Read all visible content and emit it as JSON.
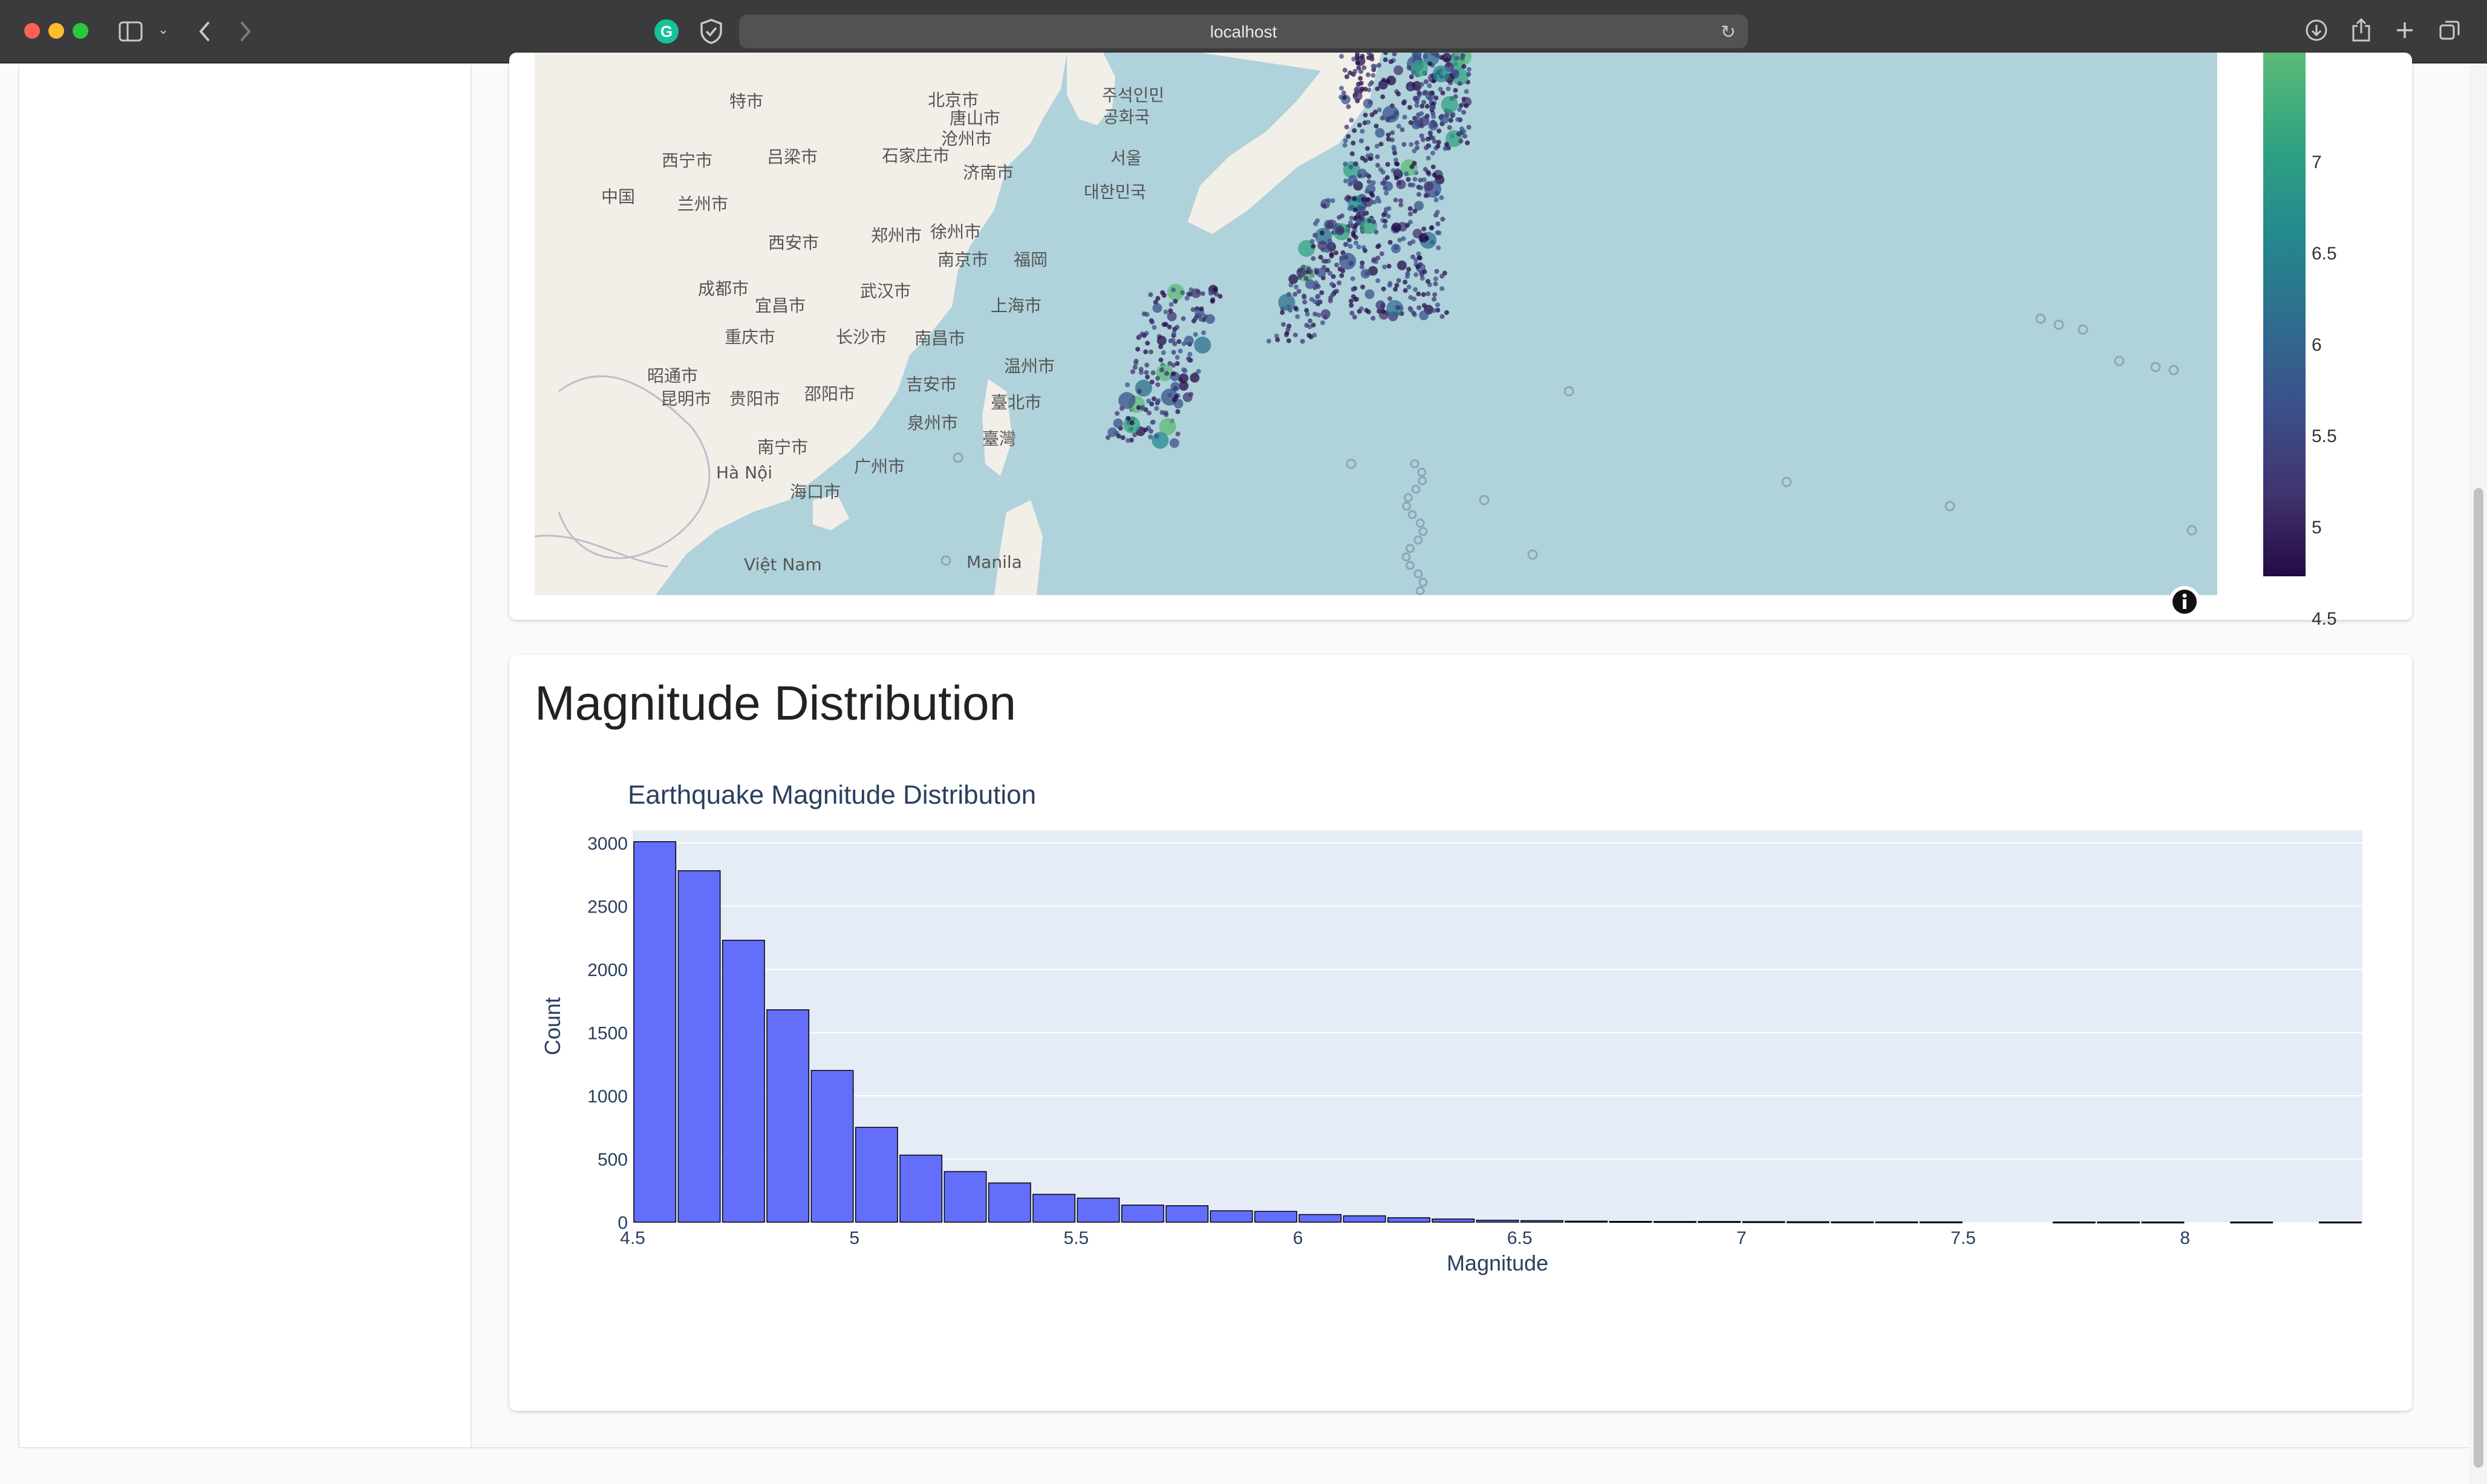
{
  "browser": {
    "url": "localhost",
    "extension_grammarly": "G"
  },
  "map": {
    "labels": [
      {
        "t": "北京市"
      },
      {
        "t": "唐山市"
      },
      {
        "t": "沧州市"
      },
      {
        "t": "济南市"
      },
      {
        "t": "石家庄市"
      },
      {
        "t": "吕梁市"
      },
      {
        "t": "西宁市"
      },
      {
        "t": "中国"
      },
      {
        "t": "兰州市"
      },
      {
        "t": "郑州市"
      },
      {
        "t": "徐州市"
      },
      {
        "t": "西安市"
      },
      {
        "t": "南京市"
      },
      {
        "t": "成都市"
      },
      {
        "t": "武汉市"
      },
      {
        "t": "宜昌市"
      },
      {
        "t": "上海市"
      },
      {
        "t": "重庆市"
      },
      {
        "t": "长沙市"
      },
      {
        "t": "南昌市"
      },
      {
        "t": "温州市"
      },
      {
        "t": "昭通市"
      },
      {
        "t": "吉安市"
      },
      {
        "t": "昆明市"
      },
      {
        "t": "贵阳市"
      },
      {
        "t": "邵阳市"
      },
      {
        "t": "泉州市"
      },
      {
        "t": "臺北市"
      },
      {
        "t": "臺灣"
      },
      {
        "t": "南宁市"
      },
      {
        "t": "广州市"
      },
      {
        "t": "Hà Nội"
      },
      {
        "t": "海口市"
      },
      {
        "t": "Việt Nam"
      },
      {
        "t": "Manila"
      },
      {
        "t": "대한민국"
      },
      {
        "t": "서울"
      },
      {
        "t": "주석인민"
      },
      {
        "t": "공화국"
      },
      {
        "t": "福岡"
      },
      {
        "t": "特市"
      }
    ],
    "colorbar_ticks": [
      "7",
      "6.5",
      "6",
      "5.5",
      "5",
      "4.5"
    ],
    "colorbar_colors": [
      "#240b45",
      "#41346f",
      "#3b518b",
      "#2e6f8e",
      "#238a8d",
      "#31a380",
      "#5cbb76"
    ]
  },
  "section": {
    "title": "Magnitude Distribution"
  },
  "chart_data": {
    "type": "bar",
    "title": "Earthquake Magnitude Distribution",
    "xlabel": "Magnitude",
    "ylabel": "Count",
    "xlim": [
      4.5,
      8.4
    ],
    "ylim": [
      0,
      3100
    ],
    "xticks": [
      "4.5",
      "5",
      "5.5",
      "6",
      "6.5",
      "7",
      "7.5",
      "8"
    ],
    "yticks": [
      "0",
      "500",
      "1000",
      "1500",
      "2000",
      "2500",
      "3000"
    ],
    "bin_width": 0.1,
    "bins": [
      {
        "x": 4.5,
        "count": 3010
      },
      {
        "x": 4.6,
        "count": 2780
      },
      {
        "x": 4.7,
        "count": 2230
      },
      {
        "x": 4.8,
        "count": 1680
      },
      {
        "x": 4.9,
        "count": 1200
      },
      {
        "x": 5.0,
        "count": 750
      },
      {
        "x": 5.1,
        "count": 530
      },
      {
        "x": 5.2,
        "count": 400
      },
      {
        "x": 5.3,
        "count": 310
      },
      {
        "x": 5.4,
        "count": 220
      },
      {
        "x": 5.5,
        "count": 190
      },
      {
        "x": 5.6,
        "count": 135
      },
      {
        "x": 5.7,
        "count": 130
      },
      {
        "x": 5.8,
        "count": 90
      },
      {
        "x": 5.9,
        "count": 85
      },
      {
        "x": 6.0,
        "count": 60
      },
      {
        "x": 6.1,
        "count": 50
      },
      {
        "x": 6.2,
        "count": 35
      },
      {
        "x": 6.3,
        "count": 25
      },
      {
        "x": 6.4,
        "count": 15
      },
      {
        "x": 6.5,
        "count": 12
      },
      {
        "x": 6.6,
        "count": 8
      },
      {
        "x": 6.7,
        "count": 6
      },
      {
        "x": 6.8,
        "count": 5
      },
      {
        "x": 6.9,
        "count": 5
      },
      {
        "x": 7.0,
        "count": 4
      },
      {
        "x": 7.1,
        "count": 3
      },
      {
        "x": 7.2,
        "count": 2
      },
      {
        "x": 7.3,
        "count": 2
      },
      {
        "x": 7.4,
        "count": 2
      },
      {
        "x": 7.5,
        "count": 0
      },
      {
        "x": 7.6,
        "count": 0
      },
      {
        "x": 7.7,
        "count": 1
      },
      {
        "x": 7.8,
        "count": 1
      },
      {
        "x": 7.9,
        "count": 1
      },
      {
        "x": 8.0,
        "count": 0
      },
      {
        "x": 8.1,
        "count": 1
      },
      {
        "x": 8.2,
        "count": 0
      },
      {
        "x": 8.3,
        "count": 1
      }
    ],
    "bar_color": "#636efa",
    "bar_outline": "#000000",
    "plot_bg": "#e5ecf6",
    "grid": true
  }
}
